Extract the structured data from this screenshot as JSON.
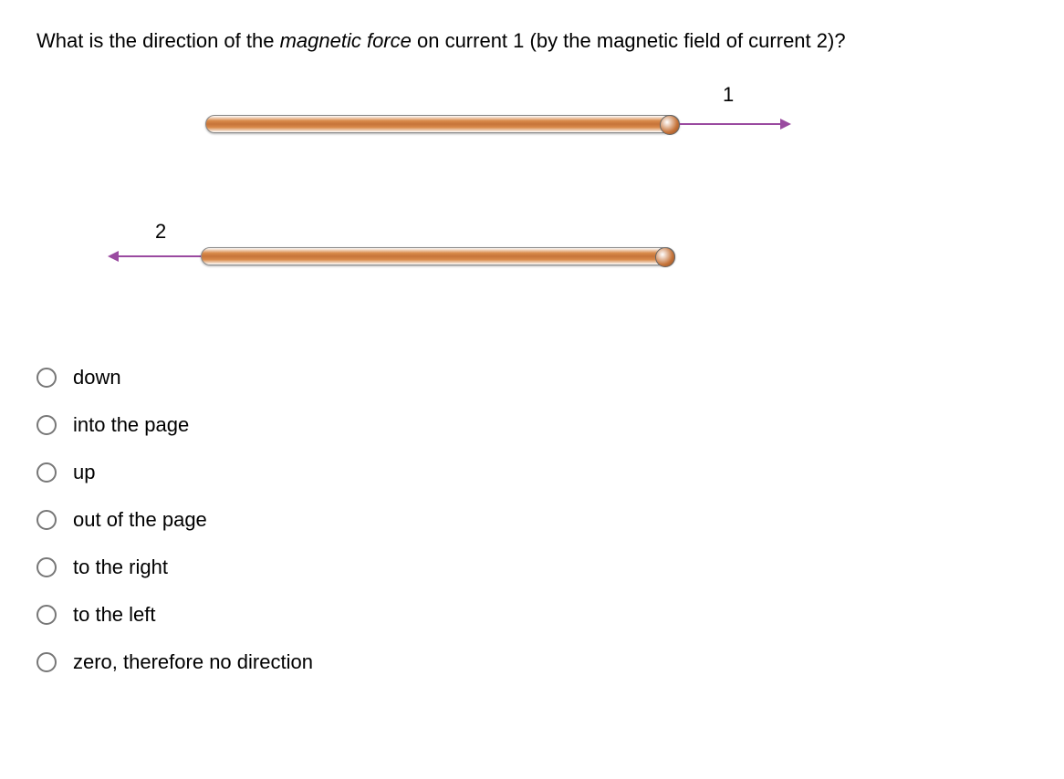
{
  "question": {
    "prefix": "What is the direction of the ",
    "emphasis": "magnetic force",
    "suffix": " on current 1 (by the magnetic field of current 2)?"
  },
  "diagram": {
    "label1": "1",
    "label2": "2"
  },
  "options": [
    {
      "label": "down"
    },
    {
      "label": "into the page"
    },
    {
      "label": "up"
    },
    {
      "label": "out of the page"
    },
    {
      "label": "to the right"
    },
    {
      "label": "to the left"
    },
    {
      "label": "zero, therefore no direction"
    }
  ]
}
